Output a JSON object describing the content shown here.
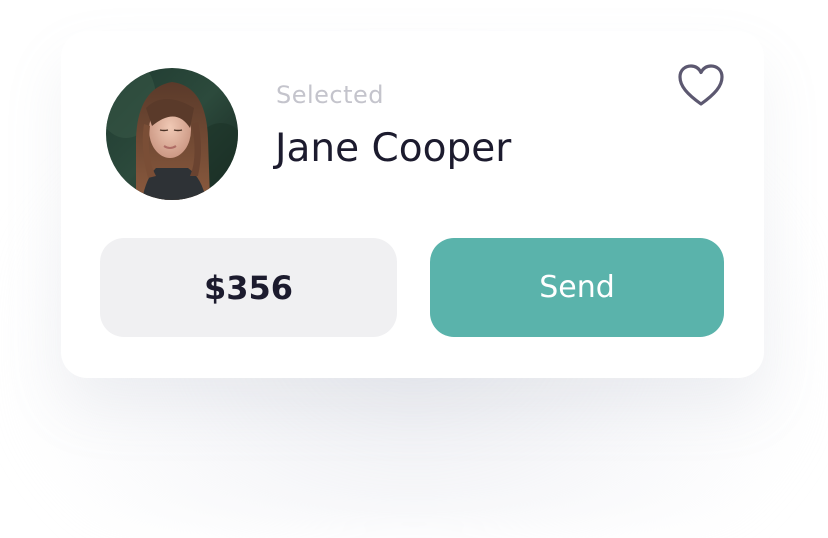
{
  "recipient": {
    "status_label": "Selected",
    "name": "Jane Cooper",
    "avatar_icon": "user-photo"
  },
  "favorite": {
    "icon": "heart-icon",
    "color": "#5c5870"
  },
  "amount": {
    "value": "$356"
  },
  "send_button": {
    "label": "Send",
    "color": "#5ab3ab"
  }
}
